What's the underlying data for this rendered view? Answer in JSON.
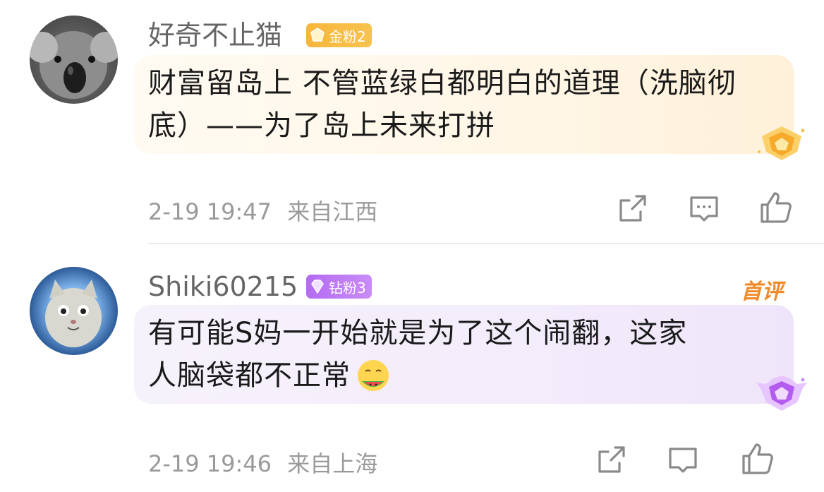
{
  "comments": [
    {
      "username": "好奇不止猫",
      "badge": {
        "label": "金粉2",
        "color": "#f7b63b"
      },
      "text": "财富留岛上  不管蓝绿白都明白的道理（洗脑彻底）——为了岛上未来打拼",
      "time": "2-19 19:47",
      "location": "来自江西",
      "avatar": "koala-avatar"
    },
    {
      "username": "Shiki60215",
      "badge": {
        "label": "钻粉3",
        "color": "#b36bf3"
      },
      "tag": "首评",
      "text_line1": "有可能S妈一开始就是为了这个闹翻，这家",
      "text_line2": "人脑袋都不正常",
      "emoji": "watermelon-eating-emoji",
      "time": "2-19 19:46",
      "location": "来自上海",
      "avatar": "cat-avatar"
    }
  ],
  "icons": [
    "share-icon",
    "comment-icon",
    "like-icon"
  ]
}
